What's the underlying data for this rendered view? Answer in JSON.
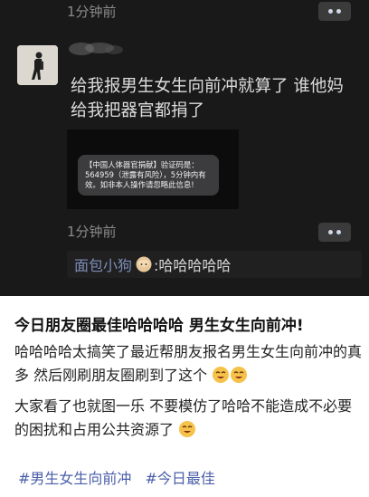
{
  "moments": {
    "time_top": "1分钟前",
    "post_text": "给我报男生女生向前冲就算了 谁他妈给我把器官都捐了",
    "sms": {
      "text": "【中国人体器官捐献】验证码是：564959（泄露有风险），5分钟内有效。如非本人操作请忽略此信息!"
    },
    "time_bottom": "1分钟前",
    "comment": {
      "name": "面包小狗",
      "text": ":哈哈哈哈哈"
    }
  },
  "article": {
    "headline": "今日朋友圈最佳哈哈哈哈 男生女生向前冲!",
    "para1": "哈哈哈哈太搞笑了最近帮朋友报名男生女生向前冲的真多 然后刚刷朋友圈刷到了这个",
    "para2": "大家看了也就图一乐 不要模仿了哈哈不能造成不必要的困扰和占用公共资源了",
    "tags": [
      "#男生女生向前冲",
      "#今日最佳"
    ]
  },
  "colors": {
    "dark_bg": "#191919",
    "link_blue": "#4a5ea8",
    "comment_name": "#7c8db8"
  }
}
